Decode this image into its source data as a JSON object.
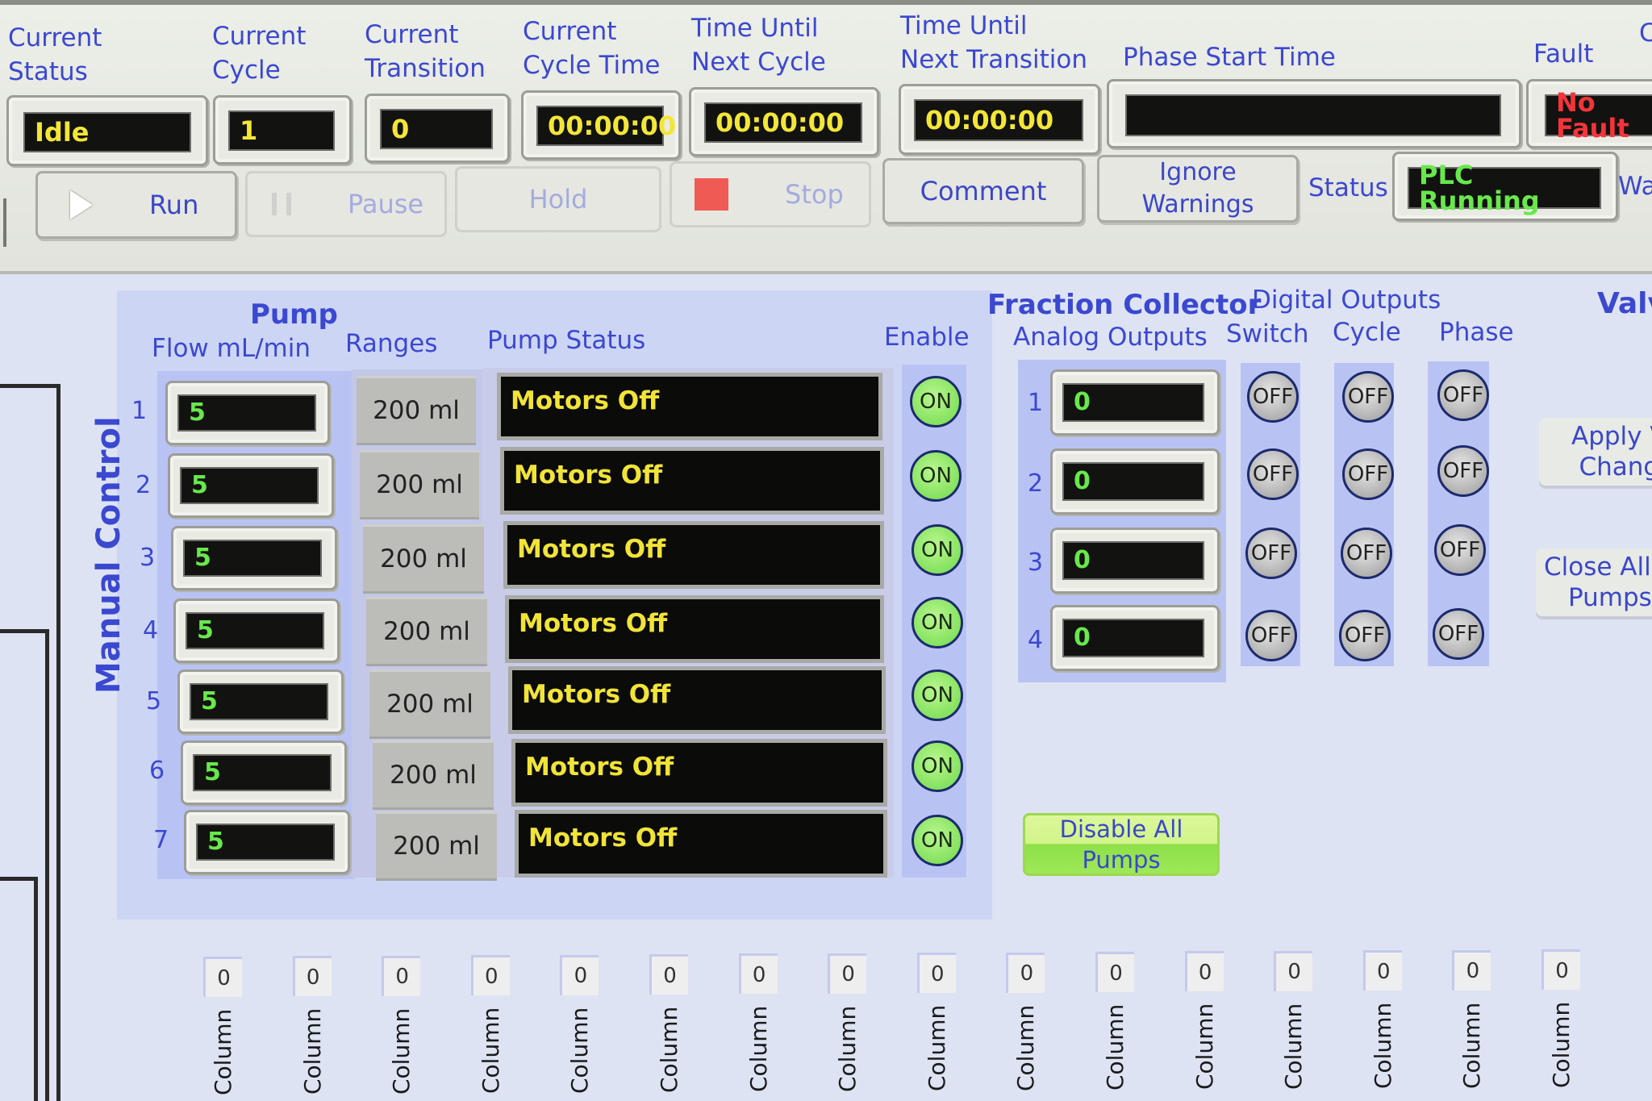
{
  "header": {
    "fields": [
      {
        "label": "Current\nStatus",
        "value": "Idle",
        "color": "yellow"
      },
      {
        "label": "Current\nCycle",
        "value": "1",
        "color": "yellow"
      },
      {
        "label": "Current\nTransition",
        "value": "0",
        "color": "yellow"
      },
      {
        "label": "Current\nCycle Time",
        "value": "00:00:00",
        "color": "yellow"
      },
      {
        "label": "Time Until\nNext Cycle",
        "value": "00:00:00",
        "color": "yellow"
      },
      {
        "label": "Time Until\nNext Transition",
        "value": "00:00:00",
        "color": "yellow"
      },
      {
        "label": "Phase Start Time",
        "value": "",
        "color": "yellow"
      },
      {
        "label": "Fault",
        "value": "No Fault",
        "color": "red"
      }
    ],
    "cut_label": "C",
    "buttons": {
      "run": "Run",
      "pause": "Pause",
      "hold": "Hold",
      "stop": "Stop",
      "comment": "Comment",
      "ignore_warnings": "Ignore\nWarnings"
    },
    "status_label": "Status",
    "status_value": "PLC Running",
    "warnings_cut_label": "Wa"
  },
  "manual_control": {
    "title": "Manual Control",
    "pump": {
      "title": "Pump",
      "flow_label": "Flow mL/min",
      "ranges_label": "Ranges",
      "status_label": "Pump Status",
      "enable_label": "Enable",
      "rows": [
        {
          "num": "1",
          "flow": "5",
          "range": "200 ml",
          "status": "Motors Off",
          "enable": "ON"
        },
        {
          "num": "2",
          "flow": "5",
          "range": "200 ml",
          "status": "Motors Off",
          "enable": "ON"
        },
        {
          "num": "3",
          "flow": "5",
          "range": "200 ml",
          "status": "Motors Off",
          "enable": "ON"
        },
        {
          "num": "4",
          "flow": "5",
          "range": "200 ml",
          "status": "Motors Off",
          "enable": "ON"
        },
        {
          "num": "5",
          "flow": "5",
          "range": "200 ml",
          "status": "Motors Off",
          "enable": "ON"
        },
        {
          "num": "6",
          "flow": "5",
          "range": "200 ml",
          "status": "Motors Off",
          "enable": "ON"
        },
        {
          "num": "7",
          "flow": "5",
          "range": "200 ml",
          "status": "Motors Off",
          "enable": "ON"
        }
      ]
    },
    "fraction_collector": {
      "title": "Fraction Collector",
      "analog_label": "Analog Outputs",
      "digital_label": "Digital Outputs",
      "switch_label": "Switch",
      "cycle_label": "Cycle",
      "phase_label": "Phase",
      "rows": [
        {
          "num": "1",
          "analog": "0",
          "switch": "OFF",
          "cycle": "OFF",
          "phase": "OFF"
        },
        {
          "num": "2",
          "analog": "0",
          "switch": "OFF",
          "cycle": "OFF",
          "phase": "OFF"
        },
        {
          "num": "3",
          "analog": "0",
          "switch": "OFF",
          "cycle": "OFF",
          "phase": "OFF"
        },
        {
          "num": "4",
          "analog": "0",
          "switch": "OFF",
          "cycle": "OFF",
          "phase": "OFF"
        }
      ],
      "disable_all": "Disable All\nPumps"
    },
    "valves": {
      "title_cut": "Valv",
      "apply_cut": "Apply V\nChang",
      "close_all_cut": "Close All V\nPumps"
    }
  },
  "columns": [
    {
      "value": "0",
      "label": "Column"
    },
    {
      "value": "0",
      "label": "Column"
    },
    {
      "value": "0",
      "label": "Column"
    },
    {
      "value": "0",
      "label": "Column"
    },
    {
      "value": "0",
      "label": "Column"
    },
    {
      "value": "0",
      "label": "Column"
    },
    {
      "value": "0",
      "label": "Column"
    },
    {
      "value": "0",
      "label": "Column"
    },
    {
      "value": "0",
      "label": "Column"
    },
    {
      "value": "0",
      "label": "Column"
    },
    {
      "value": "0",
      "label": "Column"
    },
    {
      "value": "0",
      "label": "Column"
    },
    {
      "value": "0",
      "label": "Column"
    },
    {
      "value": "0",
      "label": "Column"
    },
    {
      "value": "0",
      "label": "Column"
    },
    {
      "value": "0",
      "label": "Column"
    }
  ],
  "colors": {
    "label_blue": "#3b48d0",
    "lcd_yellow": "#f3e637",
    "lcd_green": "#68e84c",
    "lcd_red": "#f3343a",
    "stop_red": "#f05a55",
    "led_on": "#6fd94b"
  }
}
